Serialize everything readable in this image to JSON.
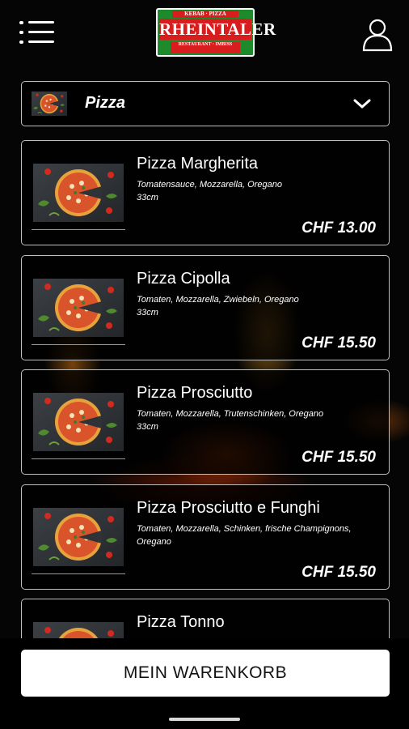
{
  "header": {
    "menu_icon": "hamburger-menu-icon",
    "logo": {
      "top_text": "KEBAB · PIZZA",
      "main_text": "RHEINTALER",
      "sub_text": "RESTAURANT · IMBISS"
    },
    "user_icon": "user-icon"
  },
  "category": {
    "selected": "Pizza",
    "icon": "chevron-down-icon"
  },
  "products": [
    {
      "name": "Pizza Margherita",
      "description": "Tomatensauce, Mozzarella, Oregano",
      "size": "33cm",
      "price": "CHF 13.00"
    },
    {
      "name": "Pizza Cipolla",
      "description": "Tomaten, Mozzarella, Zwiebeln, Oregano",
      "size": "33cm",
      "price": "CHF 15.50"
    },
    {
      "name": "Pizza Prosciutto",
      "description": "Tomaten, Mozzarella, Trutenschinken, Oregano",
      "size": "33cm",
      "price": "CHF 15.50"
    },
    {
      "name": "Pizza Prosciutto e Funghi",
      "description": "Tomaten, Mozzarella, Schinken, frische Champignons, Oregano",
      "size": "",
      "price": "CHF 15.50"
    },
    {
      "name": "Pizza Tonno",
      "description": "",
      "size": "",
      "price": ""
    }
  ],
  "cart": {
    "label": "MEIN WARENKORB"
  },
  "colors": {
    "background": "#050505",
    "logo_green": "#1d8a2b",
    "logo_red": "#d71d1d",
    "card_border": "#bfbfbf"
  }
}
